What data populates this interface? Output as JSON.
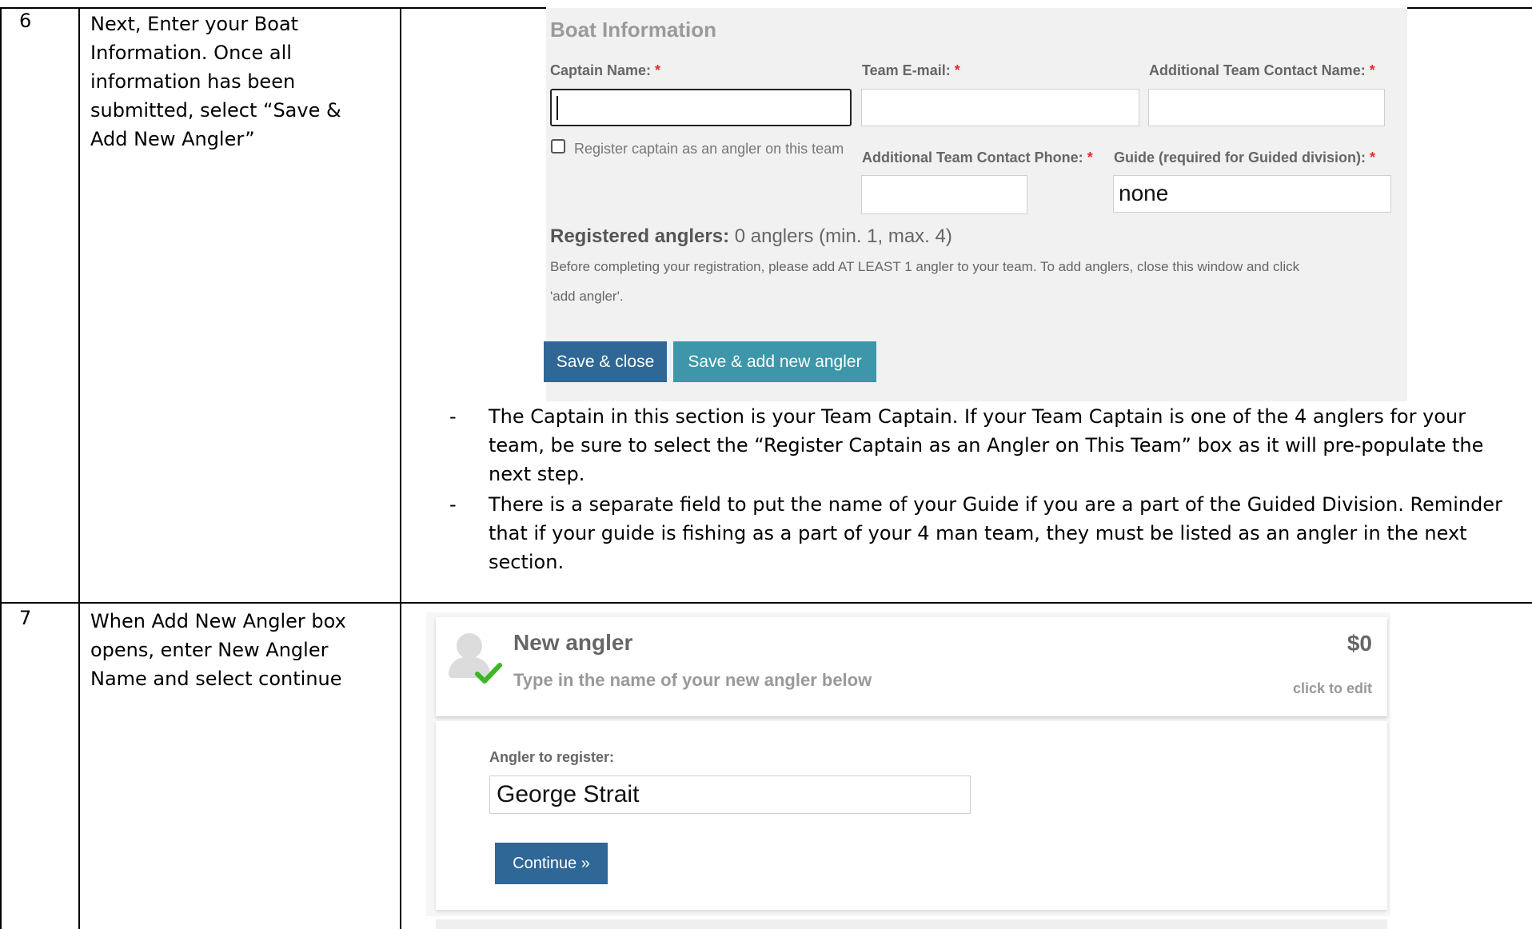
{
  "rows": [
    {
      "number": "6",
      "instruction_lines": [
        "Next, Enter your Boat",
        "Information. Once all",
        "information has been",
        "submitted, select “Save &",
        "Add New Angler”"
      ]
    },
    {
      "number": "7",
      "instruction_lines": [
        "When Add New Angler box",
        "opens, enter New Angler",
        "Name and select continue"
      ]
    }
  ],
  "boat_form": {
    "title": "Boat Information",
    "required_mark": "*",
    "captain_label": "Captain Name:",
    "team_email_label": "Team E-mail:",
    "additional_contact_name_label": "Additional Team Contact Name:",
    "register_captain_label": "Register captain as an angler on this team",
    "additional_contact_phone_label": "Additional Team Contact Phone:",
    "guide_label": "Guide (required for Guided division):",
    "guide_value": "none",
    "registered_label": "Registered anglers:",
    "registered_value": "0 anglers (min. 1, max. 4)",
    "note_line1": "Before completing your registration, please add AT LEAST 1 angler to your team. To add anglers, close this window and click",
    "note_line2": "'add angler'.",
    "save_close_label": "Save & close",
    "save_add_label": "Save & add new angler"
  },
  "bullets": [
    {
      "dash": "-",
      "lines": [
        "The Captain in this section is your Team Captain. If your Team Captain is one of the 4 anglers for your",
        "team, be sure to select the “Register Captain as an Angler on This Team” box as it will pre-populate the",
        "next step."
      ]
    },
    {
      "dash": "-",
      "lines": [
        "There is a separate field to put the name of your Guide if you are a part of the Guided Division. Reminder",
        "that if your guide is fishing as a part of your 4 man team, they must be listed as an angler in the next",
        "section."
      ]
    }
  ],
  "angler_card": {
    "title": "New angler",
    "subtitle": "Type in the name of your new angler below",
    "price": "$0",
    "edit_label": "click to edit",
    "angler_label": "Angler to register:",
    "angler_value": "George Strait",
    "continue_label": "Continue »"
  },
  "colors": {
    "check_icon": "#3cb526",
    "primary_button": "#2f6797",
    "secondary_button": "#3d96a9",
    "required": "#d9302c"
  }
}
